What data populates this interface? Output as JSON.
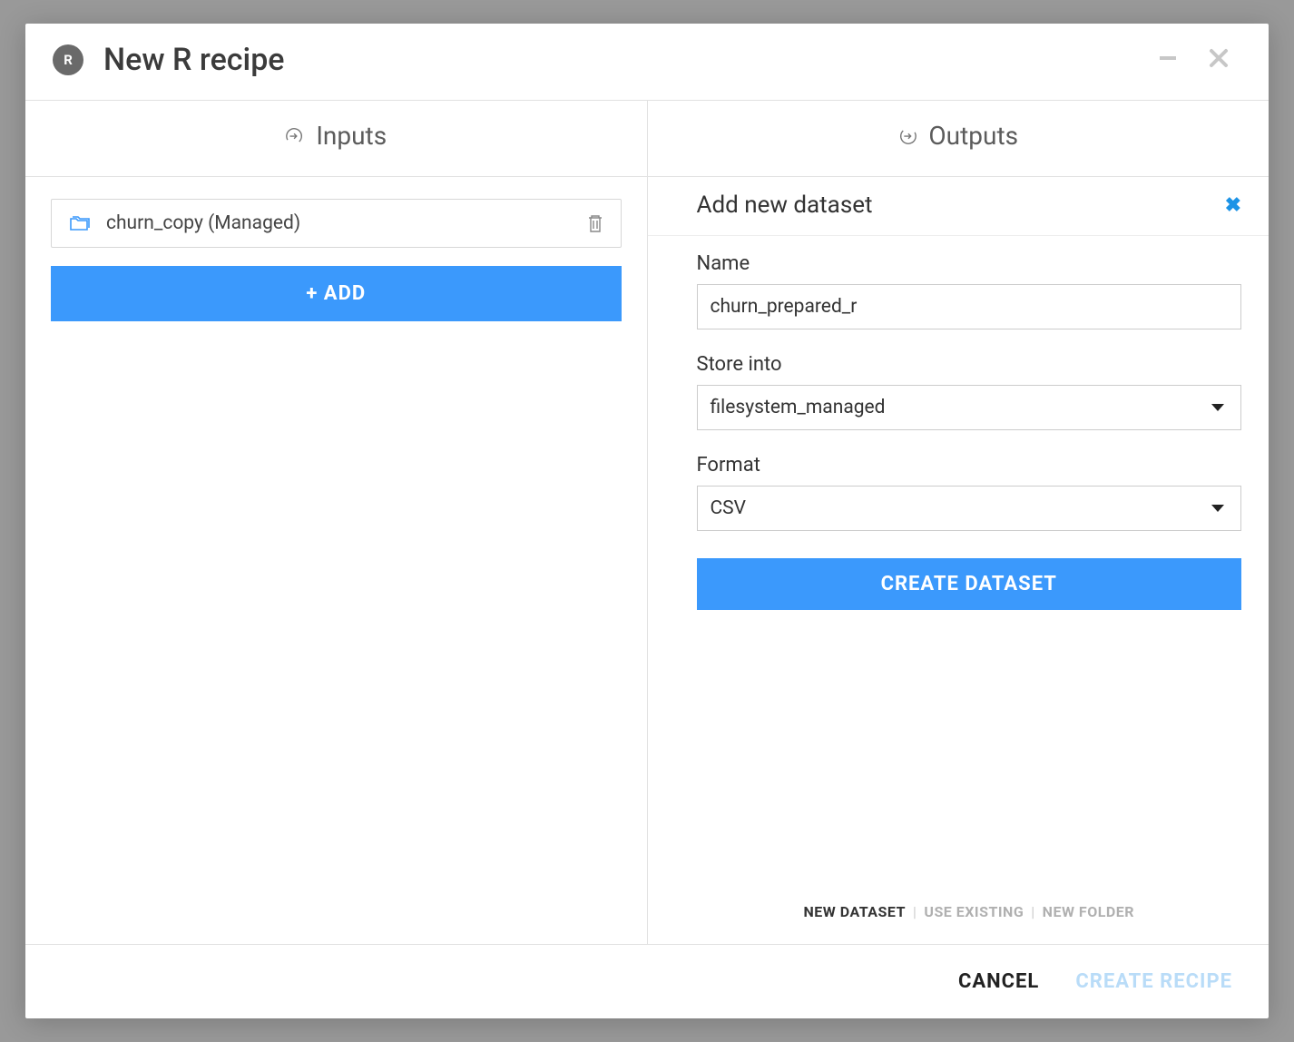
{
  "header": {
    "title": "New R recipe",
    "icon_letter": "R"
  },
  "inputs": {
    "section_label": "Inputs",
    "items": [
      {
        "name": "churn_copy (Managed)"
      }
    ],
    "add_label": "+ ADD"
  },
  "outputs": {
    "section_label": "Outputs",
    "panel_title": "Add new dataset",
    "fields": {
      "name_label": "Name",
      "name_value": "churn_prepared_r",
      "store_label": "Store into",
      "store_value": "filesystem_managed",
      "format_label": "Format",
      "format_value": "CSV"
    },
    "create_dataset_label": "CREATE DATASET",
    "tabs": {
      "new_dataset": "NEW DATASET",
      "use_existing": "USE EXISTING",
      "new_folder": "NEW FOLDER"
    }
  },
  "footer": {
    "cancel": "CANCEL",
    "create": "CREATE RECIPE"
  }
}
